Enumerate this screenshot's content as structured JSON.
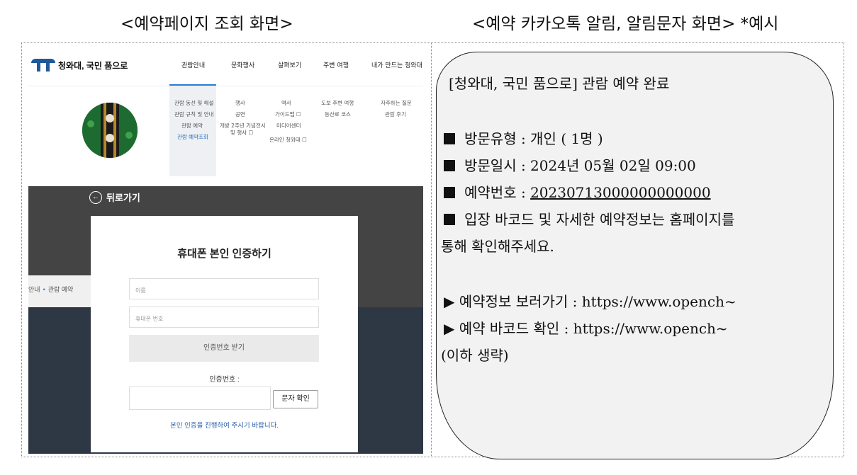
{
  "captions": {
    "left": "<예약페이지 조회 화면>",
    "right": "<예약 카카오톡 알림, 알림문자 화면> *예시"
  },
  "site": {
    "logo_text": "청와대, 국민 품으로",
    "nav": [
      "관람안내",
      "문화행사",
      "살펴보기",
      "주변 여행",
      "내가 만드는 청와대"
    ],
    "submenu": {
      "col1": [
        "관람 동선 및 해설",
        "관람 규칙 및 안내",
        "관람 예약",
        "관람 예약조회"
      ],
      "col2": [
        "행사",
        "공연",
        "개방 2주년 기념전시",
        "및 행사 ☐"
      ],
      "col3": [
        "역사",
        "가이드맵 ☐",
        "미디어센터",
        "온라인 청와대 ☐"
      ],
      "col4": [
        "도보 주변 여행",
        "등산로 코스"
      ],
      "col5": [
        "자주하는 질문",
        "관람 후기"
      ]
    },
    "back_label": "뒤로가기",
    "breadcrumb": [
      "안내",
      "관람 예약"
    ]
  },
  "modal": {
    "title": "휴대폰 본인 인증하기",
    "name_placeholder": "이름",
    "phone_placeholder": "휴대폰 번호",
    "request_button": "인증번호 받기",
    "code_label": "인증번호 :",
    "confirm_button": "문자 확인",
    "notice": "본인 인증을 진행하여 주시기 바랍니다."
  },
  "message": {
    "title": "[청와대, 국민 품으로] 관람 예약 완료",
    "visit_type": "방문유형 : 개인 ( 1명 )",
    "visit_date": "방문일시 : 2024년 05월 02일 09:00",
    "reservation_label": "예약번호 : ",
    "reservation_number": "20230713000000000000",
    "notice_line1": "입장 바코드 및 자세한 예약정보는 홈페이지를",
    "notice_line2": "통해 확인해주세요.",
    "link1": "▶ 예약정보 보러가기 : https://www.opench~",
    "link2": "▶ 예약 바코드 확인 : https://www.opench~",
    "omitted": "(이하 생략)"
  },
  "colors": {
    "accent_blue": "#2a7bd4",
    "logo_blue": "#1e5a9a",
    "notice_blue": "#2a5ea8",
    "overlay_dark": "#444444"
  }
}
